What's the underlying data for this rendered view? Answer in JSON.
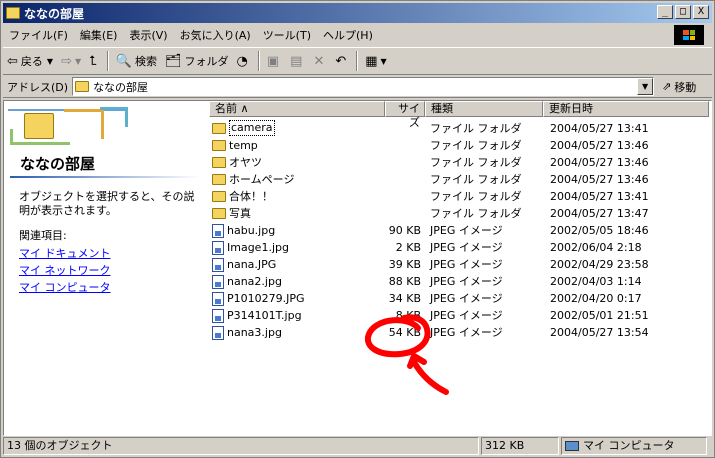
{
  "window": {
    "title": "ななの部屋"
  },
  "caption": {
    "minimize": "_",
    "maximize": "□",
    "close": "X"
  },
  "menu": [
    "ファイル(F)",
    "編集(E)",
    "表示(V)",
    "お気に入り(A)",
    "ツール(T)",
    "ヘルプ(H)"
  ],
  "toolbar": {
    "back": "戻る",
    "search": "検索",
    "folders": "フォルダ"
  },
  "address": {
    "label": "アドレス(D)",
    "value": "ななの部屋",
    "go": "移動"
  },
  "left_panel": {
    "title": "ななの部屋",
    "description": "オブジェクトを選択すると、その説明が表示されます。",
    "related": "関連項目:",
    "links": [
      "マイ ドキュメント",
      "マイ ネットワーク",
      "マイ コンピュータ"
    ]
  },
  "columns": {
    "name": "名前 ∧",
    "size": "サイズ",
    "type": "種類",
    "date": "更新日時"
  },
  "files": [
    {
      "name": "camera",
      "size": "",
      "type": "ファイル フォルダ",
      "date": "2004/05/27 13:41",
      "icon": "folder"
    },
    {
      "name": "temp",
      "size": "",
      "type": "ファイル フォルダ",
      "date": "2004/05/27 13:46",
      "icon": "folder"
    },
    {
      "name": "オヤツ",
      "size": "",
      "type": "ファイル フォルダ",
      "date": "2004/05/27 13:46",
      "icon": "folder"
    },
    {
      "name": "ホームページ",
      "size": "",
      "type": "ファイル フォルダ",
      "date": "2004/05/27 13:46",
      "icon": "folder"
    },
    {
      "name": "合体！！",
      "size": "",
      "type": "ファイル フォルダ",
      "date": "2004/05/27 13:41",
      "icon": "folder"
    },
    {
      "name": "写真",
      "size": "",
      "type": "ファイル フォルダ",
      "date": "2004/05/27 13:47",
      "icon": "folder"
    },
    {
      "name": "habu.jpg",
      "size": "90 KB",
      "type": "JPEG イメージ",
      "date": "2002/05/05 18:46",
      "icon": "jpeg"
    },
    {
      "name": "Image1.jpg",
      "size": "2 KB",
      "type": "JPEG イメージ",
      "date": "2002/06/04 2:18",
      "icon": "jpeg"
    },
    {
      "name": "nana.JPG",
      "size": "39 KB",
      "type": "JPEG イメージ",
      "date": "2002/04/29 23:58",
      "icon": "jpeg"
    },
    {
      "name": "nana2.jpg",
      "size": "88 KB",
      "type": "JPEG イメージ",
      "date": "2002/04/03 1:14",
      "icon": "jpeg"
    },
    {
      "name": "P1010279.JPG",
      "size": "34 KB",
      "type": "JPEG イメージ",
      "date": "2002/04/20 0:17",
      "icon": "jpeg"
    },
    {
      "name": "P314101T.jpg",
      "size": "8 KB",
      "type": "JPEG イメージ",
      "date": "2002/05/01 21:51",
      "icon": "jpeg"
    },
    {
      "name": "nana3.jpg",
      "size": "54 KB",
      "type": "JPEG イメージ",
      "date": "2004/05/27 13:54",
      "icon": "jpeg"
    }
  ],
  "status": {
    "count": "13 個のオブジェクト",
    "size": "312 KB",
    "location": "マイ コンピュータ"
  },
  "colors": {
    "titlebar": "#0a246a",
    "annotation": "#ff0000",
    "link": "#0000ff"
  }
}
